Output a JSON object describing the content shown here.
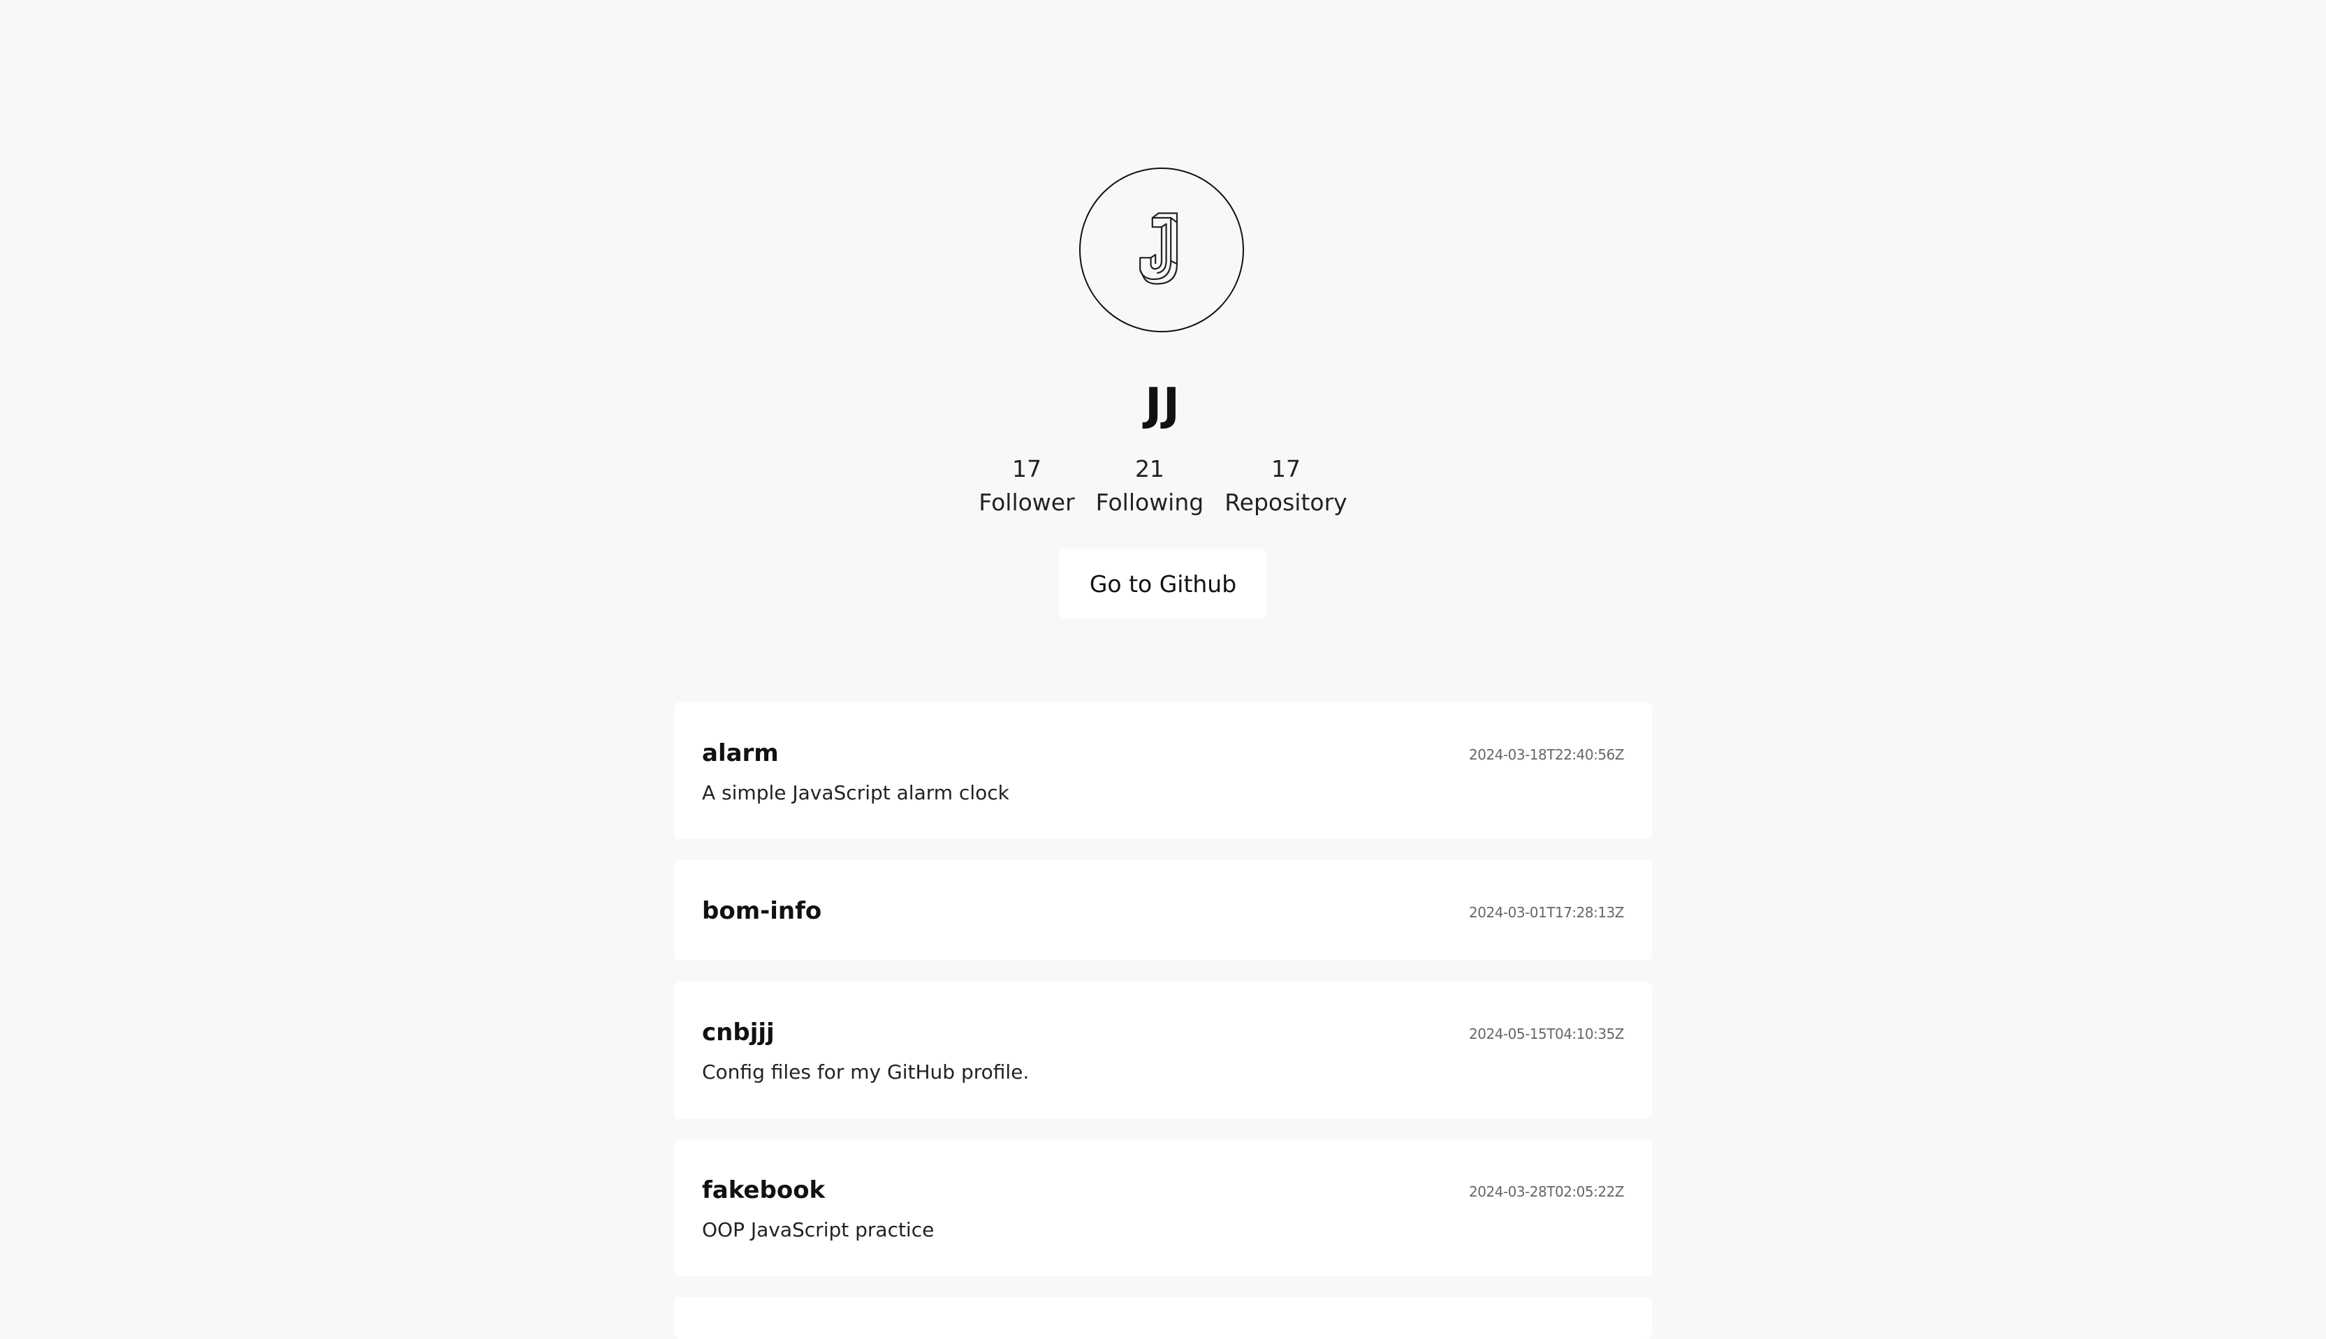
{
  "profile": {
    "avatar_icon": "letter-j-3d-icon",
    "username": "JJ",
    "stats": {
      "followers_count": "17",
      "followers_label": "Follower",
      "following_count": "21",
      "following_label": "Following",
      "repos_count": "17",
      "repos_label": "Repository"
    },
    "github_button_label": "Go to Github"
  },
  "repos": [
    {
      "name": "alarm",
      "date": "2024-03-18T22:40:56Z",
      "description": "A simple JavaScript alarm clock"
    },
    {
      "name": "bom-info",
      "date": "2024-03-01T17:28:13Z",
      "description": ""
    },
    {
      "name": "cnbjjj",
      "date": "2024-05-15T04:10:35Z",
      "description": "Config files for my GitHub profile."
    },
    {
      "name": "fakebook",
      "date": "2024-03-28T02:05:22Z",
      "description": "OOP JavaScript practice"
    }
  ],
  "colors": {
    "background": "#f8f8f8",
    "card": "#ffffff",
    "text": "#111111",
    "date_text": "#666666"
  }
}
